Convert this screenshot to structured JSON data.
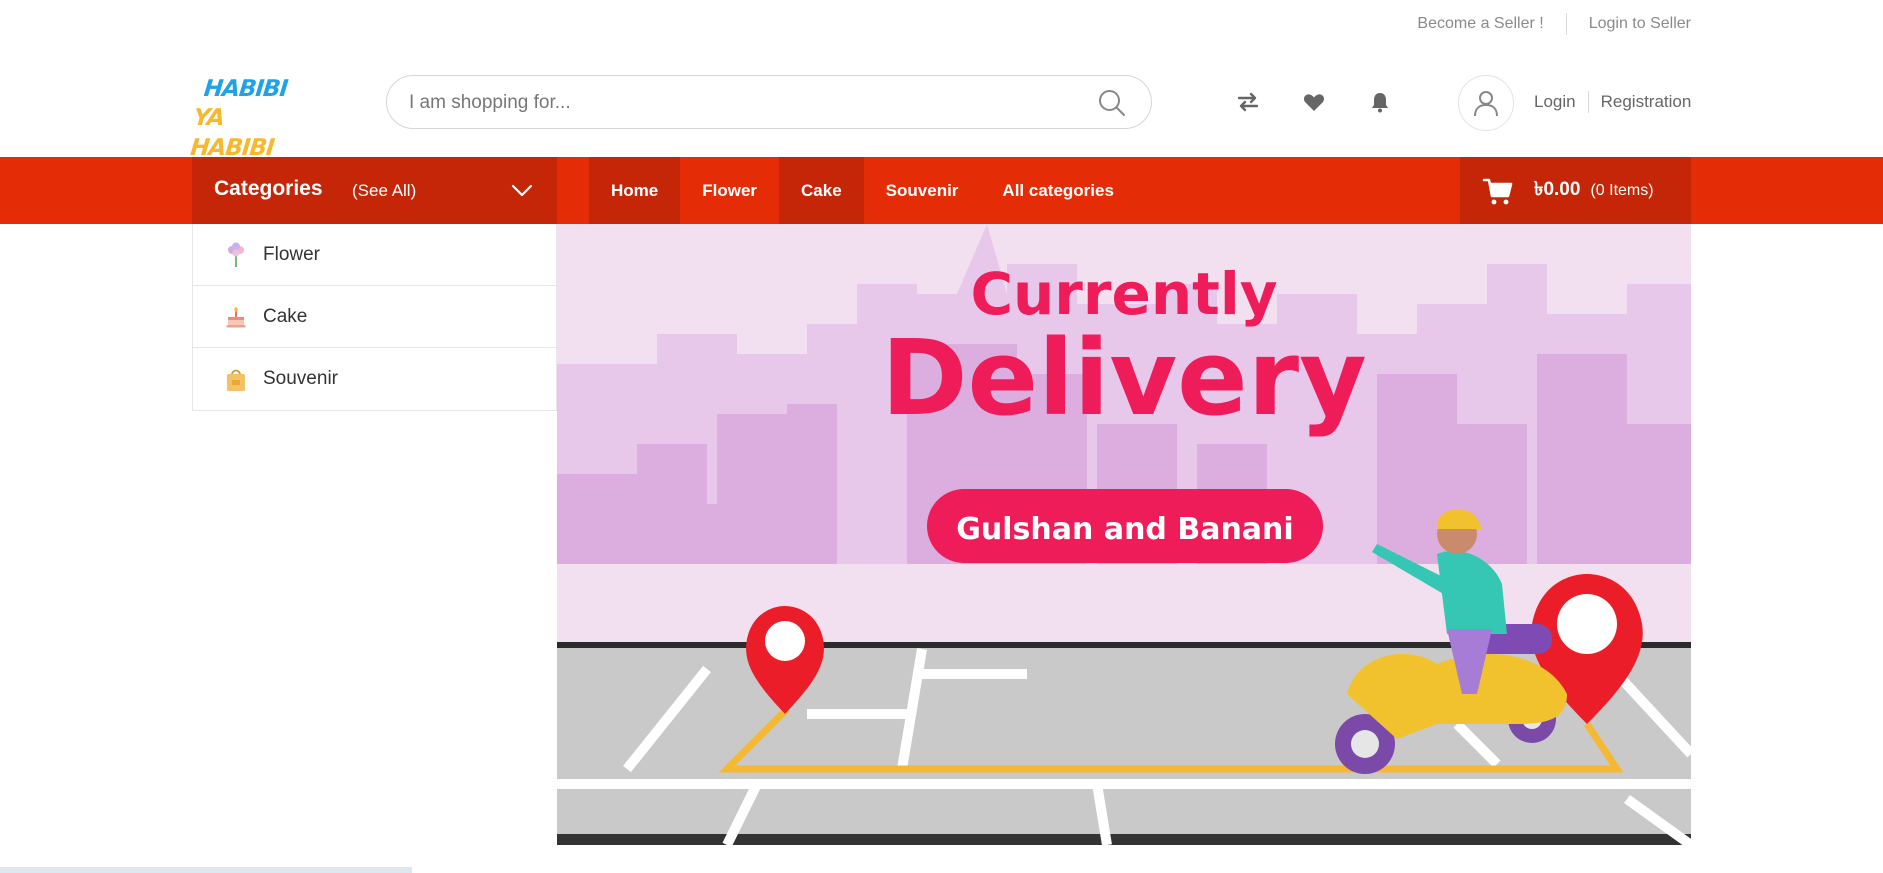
{
  "topbar": {
    "become_seller": "Become a Seller !",
    "login_seller": "Login to Seller"
  },
  "logo": {
    "line1": "HABIBI",
    "line2": "YA HABIBI"
  },
  "search": {
    "placeholder": "I am shopping for..."
  },
  "header_icons": [
    "compare-icon",
    "heart-icon",
    "bell-icon"
  ],
  "auth": {
    "login": "Login",
    "registration": "Registration"
  },
  "categories": {
    "title": "Categories",
    "see_all": "(See All)"
  },
  "nav": [
    "Home",
    "Flower",
    "Cake",
    "Souvenir",
    "All categories"
  ],
  "cart": {
    "amount": "৳0.00",
    "items": "(0 Items)"
  },
  "category_list": [
    {
      "label": "Flower",
      "icon": "flower-icon"
    },
    {
      "label": "Cake",
      "icon": "cake-icon"
    },
    {
      "label": "Souvenir",
      "icon": "gift-bag-icon"
    }
  ],
  "banner": {
    "line1": "Currently",
    "line2": "Delivery",
    "pill": "Gulshan and Banani"
  },
  "colors": {
    "brand_red": "#e42d06",
    "brand_red_dark": "#c52608",
    "banner_pink": "#ee1c59",
    "banner_bg": "#f1dcf0"
  }
}
